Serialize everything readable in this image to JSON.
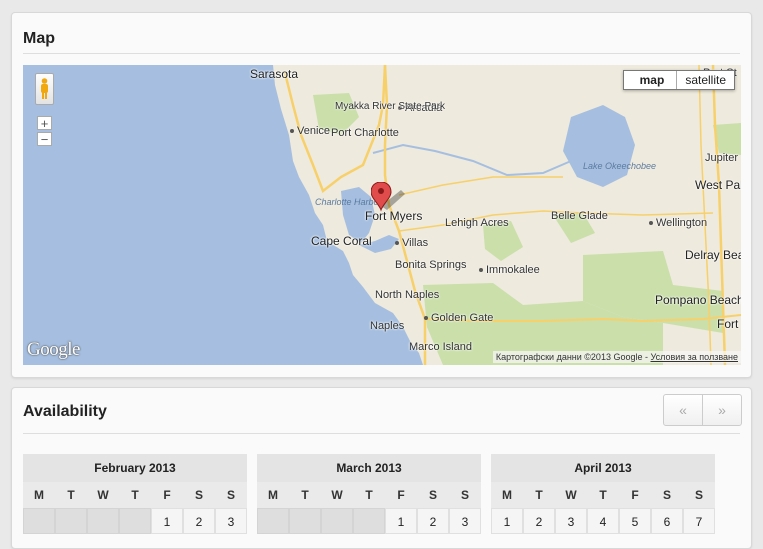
{
  "map_section": {
    "title": "Map",
    "map_type_options": [
      "map",
      "satellite"
    ],
    "zoom_in": "+",
    "zoom_out": "−",
    "google_logo": "Google",
    "attribution": "Картографски данни ©2013 Google",
    "attribution_separator": " - ",
    "terms_link": "Условия за ползване",
    "places": {
      "sarasota": "Sarasota",
      "arcadia": "Arcadia",
      "myakka": "Myakka River State Park",
      "venice": "Venice",
      "port_charlotte": "Port Charlotte",
      "lake_okeechobee": "Lake Okeechobee",
      "charlotte_harbor": "Charlotte Harbor",
      "fort_myers": "Fort Myers",
      "lehigh_acres": "Lehigh Acres",
      "belle_glade": "Belle Glade",
      "wellington": "Wellington",
      "cape_coral": "Cape Coral",
      "villas": "Villas",
      "bonita_springs": "Bonita Springs",
      "immokalee": "Immokalee",
      "north_naples": "North Naples",
      "naples": "Naples",
      "golden_gate": "Golden Gate",
      "marco_island": "Marco Island",
      "port_st": "Port St",
      "jupiter": "Jupiter",
      "west_palm_beach": "West Palm Beach",
      "delray_beach": "Delray Beach",
      "pompano_beach": "Pompano Beach",
      "fort_lauderdale": "Fort Lauderdale"
    },
    "marker_color": "#e04b4b"
  },
  "availability": {
    "title": "Availability",
    "prev_label": "«",
    "next_label": "»",
    "weekdays": [
      "M",
      "T",
      "W",
      "T",
      "F",
      "S",
      "S"
    ],
    "months": [
      {
        "name": "February 2013",
        "first_row": [
          "",
          "",
          "",
          "",
          "1",
          "2",
          "3"
        ]
      },
      {
        "name": "March 2013",
        "first_row": [
          "",
          "",
          "",
          "",
          "1",
          "2",
          "3"
        ]
      },
      {
        "name": "April 2013",
        "first_row": [
          "1",
          "2",
          "3",
          "4",
          "5",
          "6",
          "7"
        ]
      }
    ]
  },
  "colors": {
    "water": "#a6bfe0",
    "land": "#eeeadd",
    "park": "#cadfaa",
    "highway": "#f7d06a"
  }
}
